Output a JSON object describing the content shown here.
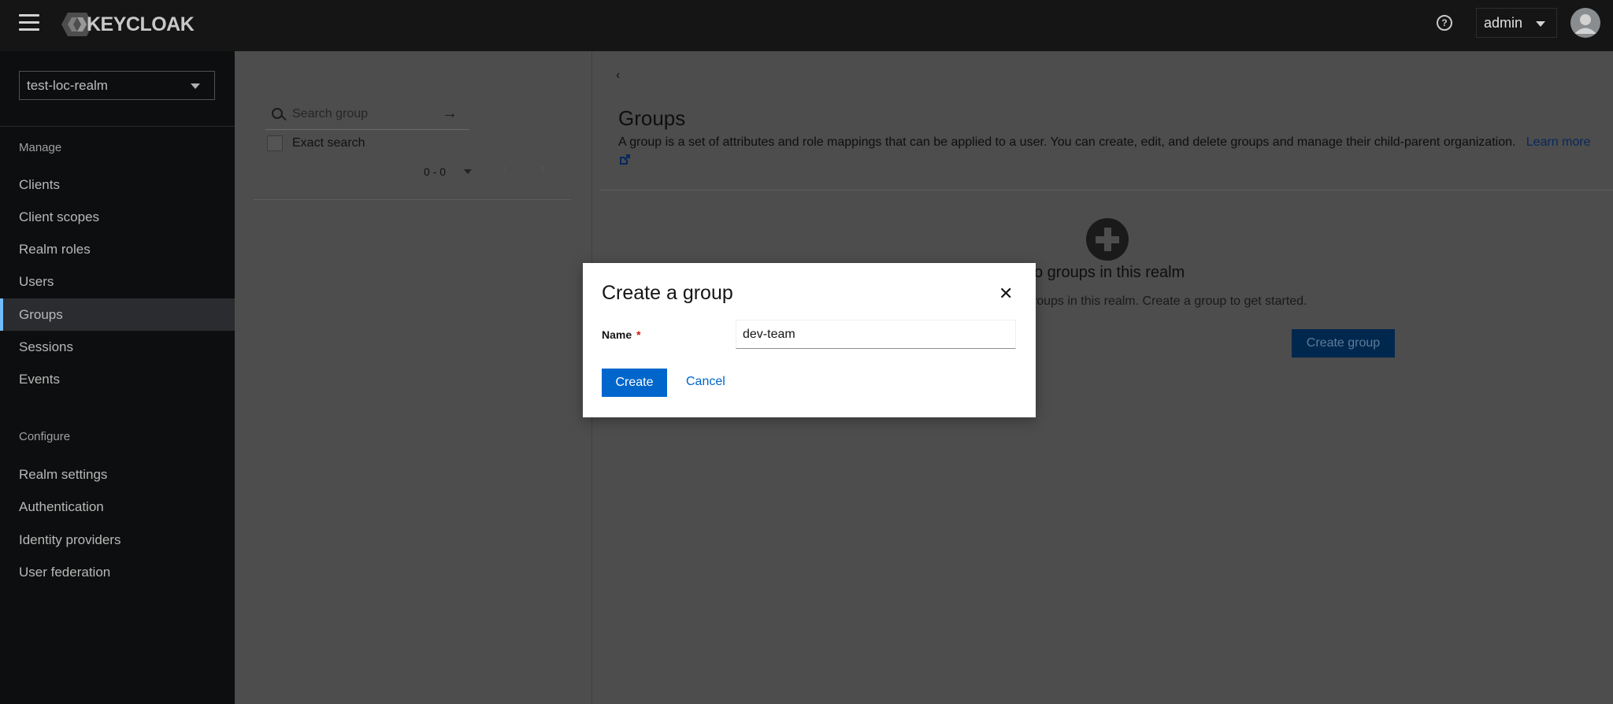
{
  "header": {
    "brand": "KEYCLOAK",
    "user_label": "admin",
    "help_glyph": "?"
  },
  "sidebar": {
    "realm": "test-loc-realm",
    "manage_label": "Manage",
    "manage_items": [
      {
        "label": "Clients"
      },
      {
        "label": "Client scopes"
      },
      {
        "label": "Realm roles"
      },
      {
        "label": "Users"
      },
      {
        "label": "Groups",
        "active": true
      },
      {
        "label": "Sessions"
      },
      {
        "label": "Events"
      }
    ],
    "configure_label": "Configure",
    "configure_items": [
      {
        "label": "Realm settings"
      },
      {
        "label": "Authentication"
      },
      {
        "label": "Identity providers"
      },
      {
        "label": "User federation"
      }
    ]
  },
  "groups_panel": {
    "search_placeholder": "Search group",
    "exact_search_label": "Exact search",
    "pager_count": "0 - 0"
  },
  "main": {
    "title": "Groups",
    "description": "A group is a set of attributes and role mappings that can be applied to a user. You can create, edit, and delete groups and manage their child-parent organization.",
    "learn_more": "Learn more",
    "empty_title": "o groups in this realm",
    "empty_body": "groups in this realm. Create a group to get started.",
    "create_group_button": "Create group"
  },
  "modal": {
    "title": "Create a group",
    "name_label": "Name",
    "required_mark": "*",
    "name_value": "dev-team",
    "create_button": "Create",
    "cancel_button": "Cancel"
  },
  "colors": {
    "header_bg": "#151515",
    "sidebar_bg": "#0d0e0f",
    "primary": "#0066cc",
    "active_indicator": "#73bcf7",
    "danger": "#c9190b"
  }
}
